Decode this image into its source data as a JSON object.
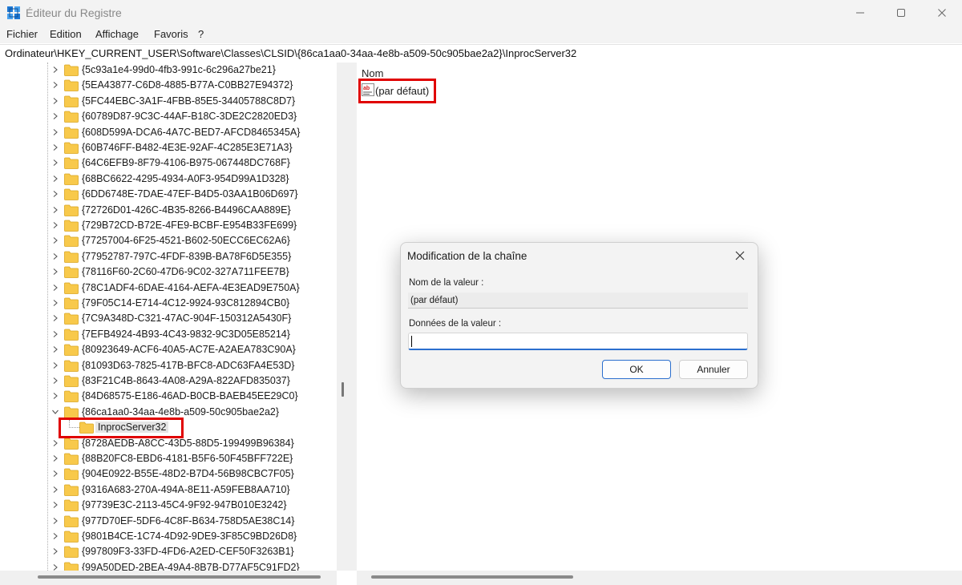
{
  "window": {
    "title": "Éditeur du Registre",
    "controls": {
      "minimize": "—",
      "maximize": "☐",
      "close": "✕"
    }
  },
  "menu": [
    "Fichier",
    "Edition",
    "Affichage",
    "Favoris",
    "?"
  ],
  "address": "Ordinateur\\HKEY_CURRENT_USER\\Software\\Classes\\CLSID\\{86ca1aa0-34aa-4e8b-a509-50c905bae2a2}\\InprocServer32",
  "tree": {
    "items_before": [
      "{5c93a1e4-99d0-4fb3-991c-6c296a27be21}",
      "{5EA43877-C6D8-4885-B77A-C0BB27E94372}",
      "{5FC44EBC-3A1F-4FBB-85E5-34405788C8D7}",
      "{60789D87-9C3C-44AF-B18C-3DE2C2820ED3}",
      "{608D599A-DCA6-4A7C-BED7-AFCD8465345A}",
      "{60B746FF-B482-4E3E-92AF-4C285E3E71A3}",
      "{64C6EFB9-8F79-4106-B975-067448DC768F}",
      "{68BC6622-4295-4934-A0F3-954D99A1D328}",
      "{6DD6748E-7DAE-47EF-B4D5-03AA1B06D697}",
      "{72726D01-426C-4B35-8266-B4496CAA889E}",
      "{729B72CD-B72E-4FE9-BCBF-E954B33FE699}",
      "{77257004-6F25-4521-B602-50ECC6EC62A6}",
      "{77952787-797C-4FDF-839B-BA78F6D5E355}",
      "{78116F60-2C60-47D6-9C02-327A711FEE7B}",
      "{78C1ADF4-6DAE-4164-AEFA-4E3EAD9E750A}",
      "{79F05C14-E714-4C12-9924-93C812894CB0}",
      "{7C9A348D-C321-47AC-904F-150312A5430F}",
      "{7EFB4924-4B93-4C43-9832-9C3D05E85214}",
      "{80923649-ACF6-40A5-AC7E-A2AEA783C90A}",
      "{81093D63-7825-417B-BFC8-ADC63FA4E53D}",
      "{83F21C4B-8643-4A08-A29A-822AFD835037}",
      "{84D68575-E186-46AD-B0CB-BAEB45EE29C0}"
    ],
    "expanded_key": "{86ca1aa0-34aa-4e8b-a509-50c905bae2a2}",
    "selected_child": "InprocServer32",
    "items_after": [
      "{8728AEDB-A8CC-43D5-88D5-199499B96384}",
      "{88B20FC8-EBD6-4181-B5F6-50F45BFF722E}",
      "{904E0922-B55E-48D2-B7D4-56B98CBC7F05}",
      "{9316A683-270A-494A-8E11-A59FEB8AA710}",
      "{97739E3C-2113-45C4-9F92-947B010E3242}",
      "{977D70EF-5DF6-4C8F-B634-758D5AE38C14}",
      "{9801B4CE-1C74-4D92-9DE9-3F85C9BD26D8}",
      "{997809F3-33FD-4FD6-A2ED-CEF50F3263B1}",
      "{99A50DED-2BEA-49A4-8B7B-D77AF5C91FD2}"
    ]
  },
  "values_pane": {
    "column_name": "Nom",
    "icon": "ab-string-icon",
    "rows": [
      "(par défaut)"
    ]
  },
  "dialog": {
    "title": "Modification de la chaîne",
    "value_name_label": "Nom de la valeur :",
    "value_name": "(par défaut)",
    "value_data_label": "Données de la valeur :",
    "value_data": "",
    "ok_label": "OK",
    "cancel_label": "Annuler"
  },
  "colors": {
    "highlight": "#e00000",
    "folder": "#f8c94b",
    "accent": "#2b6fce"
  }
}
